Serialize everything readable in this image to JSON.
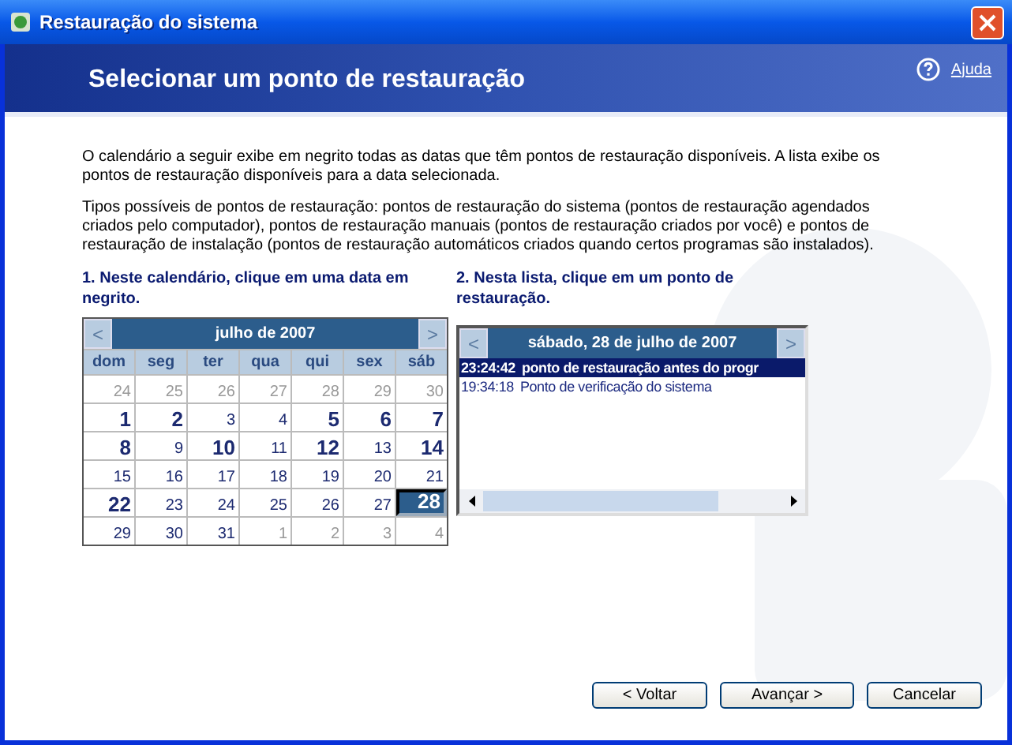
{
  "window": {
    "title": "Restauração do sistema"
  },
  "header": {
    "title": "Selecionar um ponto de restauração",
    "help_link": "Ajuda"
  },
  "intro": [
    "O calendário a seguir exibe em negrito todas as datas que têm pontos de restauração disponíveis. A lista exibe os pontos de restauração disponíveis para a data selecionada.",
    "Tipos possíveis de pontos de restauração: pontos de restauração do sistema (pontos de restauração agendados criados pelo computador), pontos de restauração manuais (pontos de restauração criados por você) e pontos de restauração de instalação (pontos de restauração automáticos criados quando certos programas são instalados)."
  ],
  "calendar": {
    "instruction": "1. Neste calendário, clique em uma data em negrito.",
    "prev": "<",
    "next": ">",
    "month": "julho de 2007",
    "weekdays": [
      "dom",
      "seg",
      "ter",
      "qua",
      "qui",
      "sex",
      "sáb"
    ],
    "weeks": [
      [
        {
          "day": "24",
          "bold": false,
          "other_month": true,
          "selected": false
        },
        {
          "day": "25",
          "bold": false,
          "other_month": true,
          "selected": false
        },
        {
          "day": "26",
          "bold": false,
          "other_month": true,
          "selected": false
        },
        {
          "day": "27",
          "bold": false,
          "other_month": true,
          "selected": false
        },
        {
          "day": "28",
          "bold": false,
          "other_month": true,
          "selected": false
        },
        {
          "day": "29",
          "bold": false,
          "other_month": true,
          "selected": false
        },
        {
          "day": "30",
          "bold": false,
          "other_month": true,
          "selected": false
        }
      ],
      [
        {
          "day": "1",
          "bold": true,
          "other_month": false,
          "selected": false
        },
        {
          "day": "2",
          "bold": true,
          "other_month": false,
          "selected": false
        },
        {
          "day": "3",
          "bold": false,
          "other_month": false,
          "selected": false
        },
        {
          "day": "4",
          "bold": false,
          "other_month": false,
          "selected": false
        },
        {
          "day": "5",
          "bold": true,
          "other_month": false,
          "selected": false
        },
        {
          "day": "6",
          "bold": true,
          "other_month": false,
          "selected": false
        },
        {
          "day": "7",
          "bold": true,
          "other_month": false,
          "selected": false
        }
      ],
      [
        {
          "day": "8",
          "bold": true,
          "other_month": false,
          "selected": false
        },
        {
          "day": "9",
          "bold": false,
          "other_month": false,
          "selected": false
        },
        {
          "day": "10",
          "bold": true,
          "other_month": false,
          "selected": false
        },
        {
          "day": "11",
          "bold": false,
          "other_month": false,
          "selected": false
        },
        {
          "day": "12",
          "bold": true,
          "other_month": false,
          "selected": false
        },
        {
          "day": "13",
          "bold": false,
          "other_month": false,
          "selected": false
        },
        {
          "day": "14",
          "bold": true,
          "other_month": false,
          "selected": false
        }
      ],
      [
        {
          "day": "15",
          "bold": false,
          "other_month": false,
          "selected": false
        },
        {
          "day": "16",
          "bold": false,
          "other_month": false,
          "selected": false
        },
        {
          "day": "17",
          "bold": false,
          "other_month": false,
          "selected": false
        },
        {
          "day": "18",
          "bold": false,
          "other_month": false,
          "selected": false
        },
        {
          "day": "19",
          "bold": false,
          "other_month": false,
          "selected": false
        },
        {
          "day": "20",
          "bold": false,
          "other_month": false,
          "selected": false
        },
        {
          "day": "21",
          "bold": false,
          "other_month": false,
          "selected": false
        }
      ],
      [
        {
          "day": "22",
          "bold": true,
          "other_month": false,
          "selected": false
        },
        {
          "day": "23",
          "bold": false,
          "other_month": false,
          "selected": false
        },
        {
          "day": "24",
          "bold": false,
          "other_month": false,
          "selected": false
        },
        {
          "day": "25",
          "bold": false,
          "other_month": false,
          "selected": false
        },
        {
          "day": "26",
          "bold": false,
          "other_month": false,
          "selected": false
        },
        {
          "day": "27",
          "bold": false,
          "other_month": false,
          "selected": false
        },
        {
          "day": "28",
          "bold": true,
          "other_month": false,
          "selected": true
        }
      ],
      [
        {
          "day": "29",
          "bold": false,
          "other_month": false,
          "selected": false
        },
        {
          "day": "30",
          "bold": false,
          "other_month": false,
          "selected": false
        },
        {
          "day": "31",
          "bold": false,
          "other_month": false,
          "selected": false
        },
        {
          "day": "1",
          "bold": false,
          "other_month": true,
          "selected": false
        },
        {
          "day": "2",
          "bold": false,
          "other_month": true,
          "selected": false
        },
        {
          "day": "3",
          "bold": false,
          "other_month": true,
          "selected": false
        },
        {
          "day": "4",
          "bold": false,
          "other_month": true,
          "selected": false
        }
      ]
    ]
  },
  "restore_list": {
    "instruction": "2. Nesta lista, clique em um ponto de restauração.",
    "prev": "<",
    "next": ">",
    "date": "sábado, 28 de julho de 2007",
    "items": [
      {
        "time": "23:24:42",
        "description": "ponto de restauração antes do progr",
        "selected": true
      },
      {
        "time": "19:34:18",
        "description": "Ponto de verificação do sistema",
        "selected": false
      }
    ]
  },
  "buttons": [
    "< Voltar",
    "Avançar >",
    "Cancelar"
  ]
}
